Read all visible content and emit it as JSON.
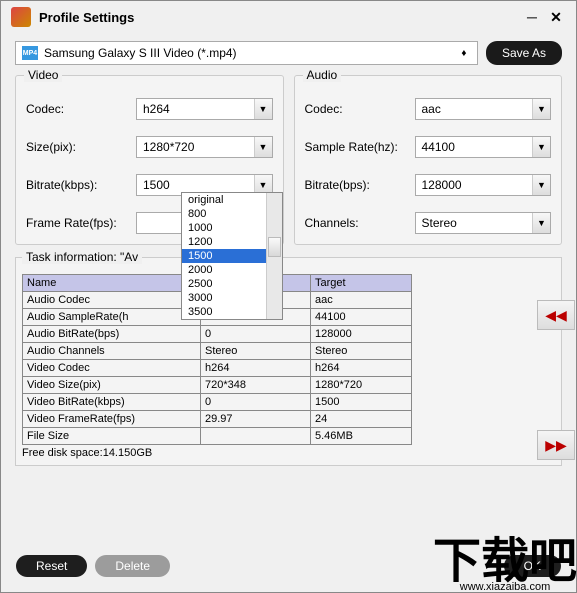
{
  "window": {
    "title": "Profile Settings"
  },
  "profile": {
    "icon_badge": "MP4",
    "selected": "Samsung Galaxy S III Video (*.mp4)",
    "save_as": "Save As"
  },
  "video": {
    "legend": "Video",
    "rows": {
      "codec_label": "Codec:",
      "codec_value": "h264",
      "size_label": "Size(pix):",
      "size_value": "1280*720",
      "bitrate_label": "Bitrate(kbps):",
      "bitrate_value": "1500",
      "framerate_label": "Frame Rate(fps):",
      "framerate_value": ""
    },
    "bitrate_options": [
      "original",
      "800",
      "1000",
      "1200",
      "1500",
      "2000",
      "2500",
      "3000",
      "3500"
    ],
    "bitrate_selected": "1500"
  },
  "audio": {
    "legend": "Audio",
    "rows": {
      "codec_label": "Codec:",
      "codec_value": "aac",
      "samplerate_label": "Sample Rate(hz):",
      "samplerate_value": "44100",
      "bitrate_label": "Bitrate(bps):",
      "bitrate_value": "128000",
      "channels_label": "Channels:",
      "channels_value": "Stereo"
    }
  },
  "task": {
    "legend": "Task information: \"Av",
    "headers": {
      "name": "Name",
      "target": "Target"
    },
    "rows": [
      {
        "name": "Audio Codec",
        "source": "",
        "target": "aac"
      },
      {
        "name": "Audio SampleRate(h",
        "source": "",
        "target": "44100"
      },
      {
        "name": "Audio BitRate(bps)",
        "source": "0",
        "target": "128000"
      },
      {
        "name": "Audio Channels",
        "source": "Stereo",
        "target": "Stereo"
      },
      {
        "name": "Video Codec",
        "source": "h264",
        "target": "h264"
      },
      {
        "name": "Video Size(pix)",
        "source": "720*348",
        "target": "1280*720"
      },
      {
        "name": "Video BitRate(kbps)",
        "source": "0",
        "target": "1500"
      },
      {
        "name": "Video FrameRate(fps)",
        "source": "29.97",
        "target": "24"
      },
      {
        "name": "File Size",
        "source": "",
        "target": "5.46MB"
      }
    ],
    "free_space": "Free disk space:14.150GB"
  },
  "buttons": {
    "reset": "Reset",
    "delete": "Delete",
    "ok": "OK"
  },
  "watermark": {
    "text": "下载吧",
    "sub": "www.xiazaiba.com"
  }
}
